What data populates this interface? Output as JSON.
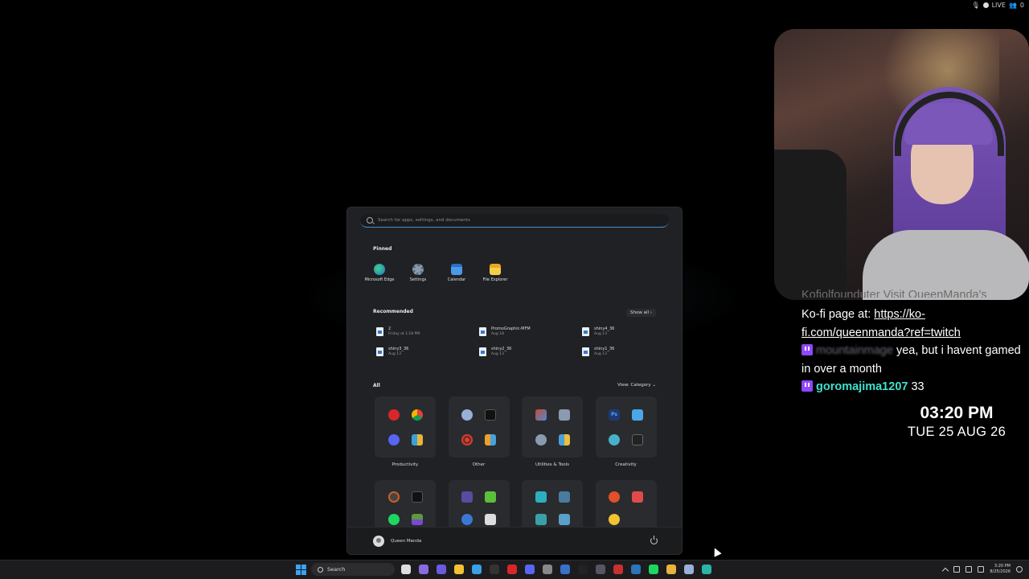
{
  "stream": {
    "live_label": "LIVE",
    "viewer_count": "0"
  },
  "chat": {
    "line1_user": "Kofiolfounduter",
    "line1_text": "Visit QueenManda's",
    "line2_text": "Ko-fi page at:",
    "line2_link": "https://ko-fi.com/queenmanda?ref=twitch",
    "line3_user": "mountainmage",
    "line3_text": "yea, but i havent gamed in over a month",
    "line4_user": "goromajima1207",
    "line4_text": "33"
  },
  "clock": {
    "time": "03:20 PM",
    "date": "TUE 25 AUG 26"
  },
  "start_menu": {
    "search_placeholder": "Search for apps, settings, and documents",
    "pinned_title": "Pinned",
    "pinned": [
      {
        "label": "Microsoft Edge",
        "icon": "edge-icon",
        "color": "#2bb3a8"
      },
      {
        "label": "Settings",
        "icon": "gear-icon",
        "color": "#8a9bb0"
      },
      {
        "label": "Calendar",
        "icon": "calendar-icon",
        "color": "#3b82d8"
      },
      {
        "label": "File Explorer",
        "icon": "folder-icon",
        "color": "#f2c230"
      }
    ],
    "recommended_title": "Recommended",
    "show_all": "Show all",
    "recommended": [
      {
        "name": "2",
        "when": "Friday at 1:18 PM"
      },
      {
        "name": "PromoGraphic-MFM",
        "when": "Aug 18"
      },
      {
        "name": "shiny4_36",
        "when": "Aug 13"
      },
      {
        "name": "shiny3_36",
        "when": "Aug 13"
      },
      {
        "name": "shiny2_36",
        "when": "Aug 13"
      },
      {
        "name": "shiny1_36",
        "when": "Aug 13"
      }
    ],
    "all_title": "All",
    "view_label": "View: Category",
    "categories": [
      {
        "label": "Productivity",
        "icons": [
          "#d9262b",
          "#e8b43a",
          "#5865f2",
          "#3aa0d8"
        ]
      },
      {
        "label": "Other",
        "icons": [
          "#9ab0d8",
          "#111111",
          "#d94030",
          "#e8a030"
        ]
      },
      {
        "label": "Utilities & Tools",
        "icons": [
          "#c84a30",
          "#8a9ab0",
          "#8a9bb0",
          "#4aa0d8"
        ]
      },
      {
        "label": "Creativity",
        "icons": [
          "#1f3a70",
          "#4aa8e8",
          "#48b0c8",
          "#222222"
        ]
      },
      {
        "label": "",
        "icons": [
          "#444444",
          "#111111",
          "#1ed760",
          "#7a4ad0"
        ]
      },
      {
        "label": "",
        "icons": [
          "#5a4aa0",
          "#5bbf3a",
          "#3a78d8",
          "#dddddd"
        ]
      },
      {
        "label": "",
        "icons": [
          "#2ab0c0",
          "#4a7aa0",
          "#3aa0a8",
          "#5aa0c8"
        ]
      },
      {
        "label": "",
        "icons": [
          "#e0502a",
          "#e04a4a",
          "#f2c230",
          "#202124"
        ]
      }
    ],
    "user_name": "Queen Manda"
  },
  "taskbar": {
    "search_label": "Search",
    "icons": [
      {
        "name": "task-view-icon",
        "color": "#dddddd"
      },
      {
        "name": "copilot-icon",
        "color": "#8a6ae0"
      },
      {
        "name": "teams-icon",
        "color": "#6a5ae0"
      },
      {
        "name": "file-explorer-icon",
        "color": "#f2c230"
      },
      {
        "name": "photos-icon",
        "color": "#3aa0e8"
      },
      {
        "name": "obs-icon",
        "color": "#333333"
      },
      {
        "name": "opera-icon",
        "color": "#d9262b"
      },
      {
        "name": "discord-icon",
        "color": "#5865f2"
      },
      {
        "name": "steam-icon",
        "color": "#888888"
      },
      {
        "name": "app-icon",
        "color": "#3a70c8"
      },
      {
        "name": "capcut-icon",
        "color": "#222222"
      },
      {
        "name": "controller-icon",
        "color": "#555566"
      },
      {
        "name": "record-icon",
        "color": "#c83030"
      },
      {
        "name": "steam2-icon",
        "color": "#2a75bb"
      },
      {
        "name": "spotify-icon",
        "color": "#1ed760"
      },
      {
        "name": "chrome-icon",
        "color": "#e8b43a"
      },
      {
        "name": "browser-icon",
        "color": "#9ab0d8"
      },
      {
        "name": "edge-icon",
        "color": "#2bb3a8"
      }
    ],
    "clock_time": "3:20 PM",
    "clock_date": "8/25/2026"
  }
}
